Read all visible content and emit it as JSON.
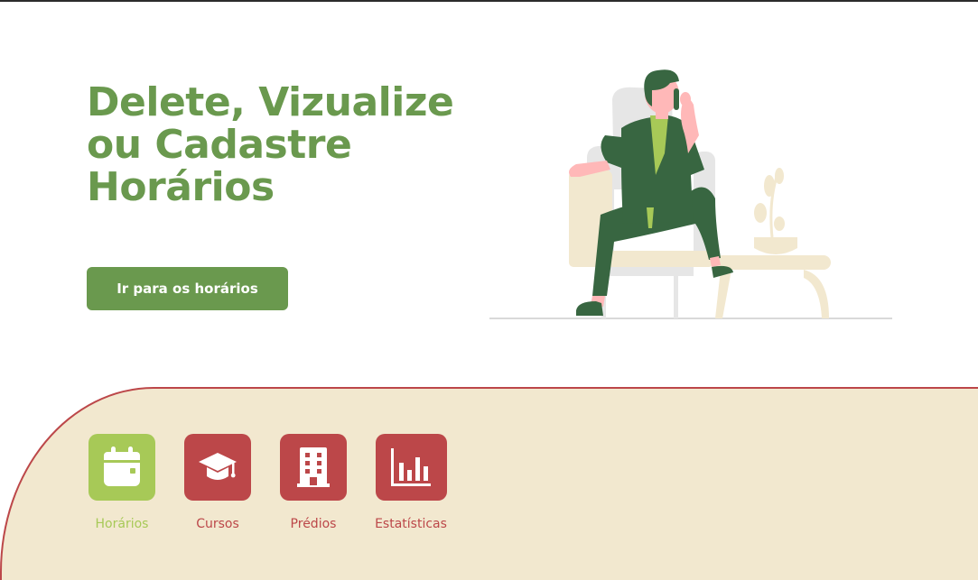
{
  "hero": {
    "title": "Delete, Vizualize ou Cadastre Horários",
    "button_label": "Ir para os horários"
  },
  "illustration": {
    "icon": "person-on-phone-in-armchair-illustration"
  },
  "nav": {
    "items": [
      {
        "label": "Horários",
        "icon": "calendar-icon",
        "active": true
      },
      {
        "label": "Cursos",
        "icon": "graduation-cap-icon",
        "active": false
      },
      {
        "label": "Prédios",
        "icon": "building-icon",
        "active": false
      },
      {
        "label": "Estatísticas",
        "icon": "bar-chart-icon",
        "active": false
      }
    ]
  },
  "colors": {
    "primary_green": "#6a994e",
    "light_green": "#a7c957",
    "accent_red": "#bc4749",
    "cream": "#f2e8cf",
    "dark_green": "#386641"
  }
}
